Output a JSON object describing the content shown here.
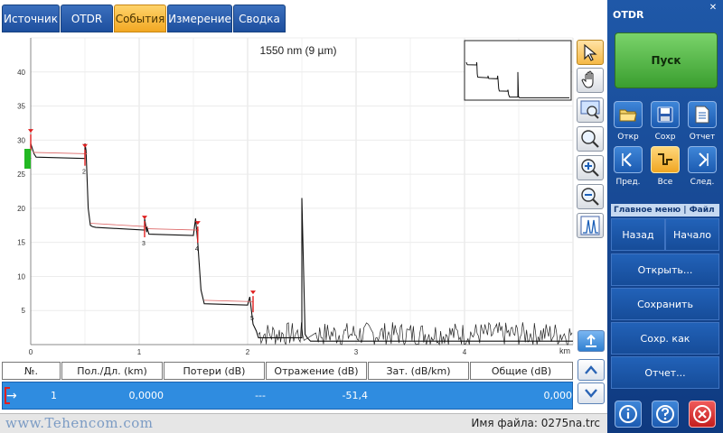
{
  "tabs": [
    {
      "label": "Источник"
    },
    {
      "label": "OTDR"
    },
    {
      "label": "События"
    },
    {
      "label": "Измерение"
    },
    {
      "label": "Сводка"
    }
  ],
  "chart_data": {
    "type": "line",
    "title": "1550 nm (9 µm)",
    "xlabel": "km",
    "ylabel": "",
    "xlim": [
      0,
      5
    ],
    "ylim": [
      0,
      45
    ],
    "x_ticks": [
      0,
      1,
      2,
      3,
      4
    ],
    "y_ticks": [
      5,
      10,
      15,
      20,
      25,
      30,
      35,
      40
    ],
    "grid": true,
    "series": [
      {
        "x": [
          0.0,
          0.03,
          0.05,
          0.5,
          0.5,
          0.51,
          0.53,
          0.55,
          0.57,
          0.6,
          1.05,
          1.05,
          1.07,
          1.07,
          1.09,
          1.5,
          1.52,
          1.54,
          1.57,
          1.6,
          2.0,
          2.02,
          2.05,
          2.08,
          2.1,
          2.5,
          2.5,
          2.53,
          2.55,
          2.58,
          2.6,
          5.0
        ],
        "y": [
          29.5,
          28.0,
          27.5,
          27.3,
          29.5,
          28.5,
          20.0,
          17.5,
          17.3,
          17.2,
          16.8,
          18.5,
          16.5,
          17.3,
          16.2,
          16.0,
          18.5,
          15.0,
          8.0,
          6.0,
          5.8,
          7.0,
          3.0,
          2.0,
          1.0,
          1.0,
          21.5,
          1.5,
          1.0,
          0.5,
          0.5,
          0.5
        ]
      }
    ],
    "event_markers": [
      {
        "label": "1",
        "x": 0.0,
        "y": 29.5
      },
      {
        "label": "2",
        "x": 0.5,
        "y": 27.3
      },
      {
        "label": "3",
        "x": 1.05,
        "y": 16.8
      },
      {
        "label": "4",
        "x": 1.54,
        "y": 16.0
      },
      {
        "label": "5",
        "x": 2.05,
        "y": 5.8
      }
    ],
    "reflections": [
      {
        "x": 0.0,
        "value": -51.4
      }
    ]
  },
  "chart_tools": [
    {
      "icon": "cursor-arrow-icon",
      "selected": true
    },
    {
      "icon": "hand-pan-icon",
      "selected": false
    },
    {
      "icon": "zoom-window-icon",
      "selected": false
    },
    {
      "icon": "zoom-fit-icon",
      "selected": false
    },
    {
      "icon": "zoom-in-icon",
      "selected": false
    },
    {
      "icon": "zoom-out-icon",
      "selected": false
    },
    {
      "icon": "event-overlay-icon",
      "selected": false
    }
  ],
  "table": {
    "columns": [
      "№.",
      "Пол./Дл. (km)",
      "Потери (dB)",
      "Отражение (dB)",
      "Зат. (dB/km)",
      "Общие (dB)"
    ],
    "row": {
      "icon": "→",
      "number": "1",
      "position": "0,0000",
      "loss": "---",
      "reflection": "-51,4",
      "attenuation": "",
      "total": "0,000"
    }
  },
  "status": {
    "watermark": "www.Tehencom.com",
    "filename_label": "Имя файла: 0275na.trc"
  },
  "panel": {
    "title": "OTDR",
    "run_label": "Пуск",
    "file_buttons": [
      {
        "label": "Откр",
        "icon": "folder-icon"
      },
      {
        "label": "Сохр",
        "icon": "save-icon"
      },
      {
        "label": "Отчет",
        "icon": "report-icon"
      }
    ],
    "nav_buttons": [
      {
        "label": "Пред.",
        "icon": "prev-event-icon"
      },
      {
        "label": "Все",
        "icon": "all-events-icon"
      },
      {
        "label": "След.",
        "icon": "next-event-icon"
      }
    ],
    "menu_header": "Главное меню | Файл",
    "back_label": "Назад",
    "start_label": "Начало",
    "menu_items": [
      "Открыть...",
      "Сохранить",
      "Сохр. как",
      "Отчет..."
    ]
  },
  "colors": {
    "tab_blue": "#1d4f9e",
    "tab_active": "#f2a823",
    "row_highlight": "#2f8ce0",
    "run_green": "#3a9e2f",
    "panel_blue": "#0f3a80",
    "exit_red": "#d12a2a",
    "event_marker": "#e02020"
  }
}
